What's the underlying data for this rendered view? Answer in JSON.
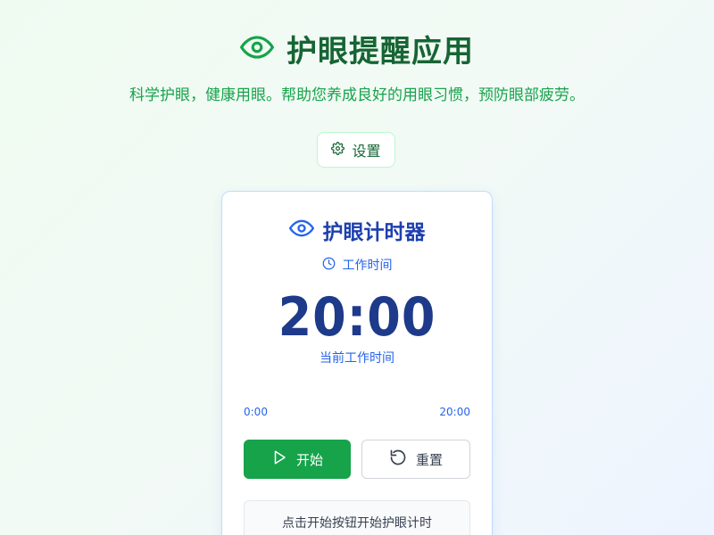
{
  "header": {
    "title": "护眼提醒应用",
    "subtitle": "科学护眼，健康用眼。帮助您养成良好的用眼习惯，预防眼部疲劳。",
    "icon": "eye-icon"
  },
  "settings": {
    "label": "设置",
    "icon": "gear-icon"
  },
  "timer": {
    "title": "护眼计时器",
    "title_icon": "eye-icon",
    "mode_label": "工作时间",
    "mode_icon": "clock-icon",
    "time": "20:00",
    "caption": "当前工作时间",
    "progress": {
      "fraction": 0,
      "start_label": "0:00",
      "end_label": "20:00"
    },
    "start_label": "开始",
    "start_icon": "play-icon",
    "reset_label": "重置",
    "reset_icon": "reset-icon",
    "hint": "点击开始按钮开始护眼计时"
  },
  "colors": {
    "brand_green": "#16a34a",
    "title_green": "#166534",
    "accent_blue": "#1e40af"
  }
}
